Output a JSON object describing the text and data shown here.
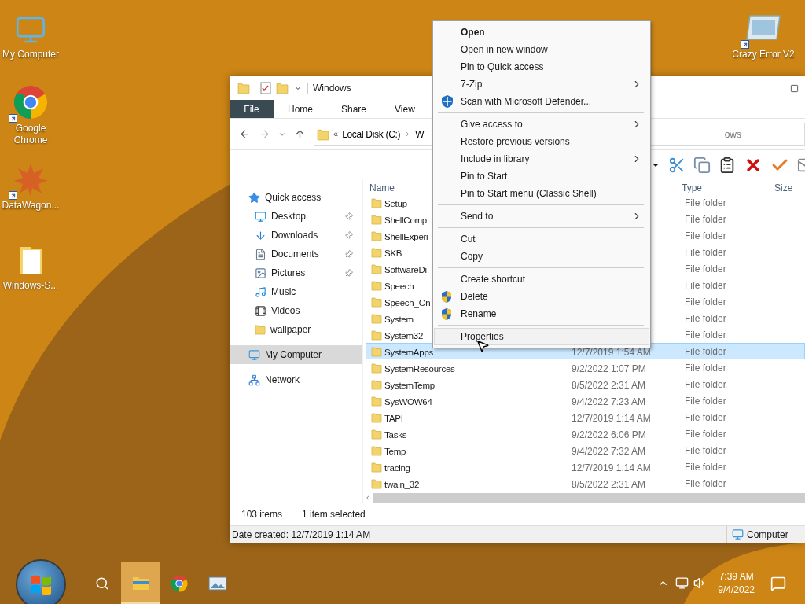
{
  "desktop_icons": [
    {
      "label": "My Computer",
      "kind": "computer",
      "shortcut": false
    },
    {
      "label": "Google Chrome",
      "kind": "chrome",
      "shortcut": true
    },
    {
      "label": "DataWagon...",
      "kind": "star",
      "shortcut": true
    },
    {
      "label": "Windows-S...",
      "kind": "file",
      "shortcut": false
    },
    {
      "label": "Crazy Error V2",
      "kind": "app",
      "shortcut": true
    }
  ],
  "explorer": {
    "title": "Windows",
    "ribbon_tabs": [
      {
        "label": "File",
        "kind": "file"
      },
      {
        "label": "Home",
        "kind": "tab"
      },
      {
        "label": "Share",
        "kind": "tab"
      },
      {
        "label": "View",
        "kind": "tab"
      }
    ],
    "address": {
      "overflow": "«",
      "parent": "Local Disk (C:)",
      "current": "W",
      "tail": "ows"
    },
    "nav": [
      {
        "label": "Quick access",
        "kind": "star",
        "selected": false,
        "children": [
          {
            "label": "Desktop",
            "kind": "desktop",
            "pinned": true,
            "selected": false
          },
          {
            "label": "Downloads",
            "kind": "download",
            "pinned": true,
            "selected": false
          },
          {
            "label": "Documents",
            "kind": "document",
            "pinned": true,
            "selected": false
          },
          {
            "label": "Pictures",
            "kind": "picture",
            "pinned": true,
            "selected": false
          },
          {
            "label": "Music",
            "kind": "music",
            "pinned": false,
            "selected": false
          },
          {
            "label": "Videos",
            "kind": "video",
            "pinned": false,
            "selected": false
          },
          {
            "label": "wallpaper",
            "kind": "folder",
            "pinned": false,
            "selected": false
          }
        ]
      },
      {
        "label": "My Computer",
        "kind": "computer",
        "selected": true
      },
      {
        "label": "Network",
        "kind": "network",
        "selected": false
      }
    ],
    "columns": [
      "Name",
      "Type",
      "Size"
    ],
    "rows": [
      {
        "name": "Setup",
        "type": "File folder",
        "selected": false
      },
      {
        "name": "ShellComp",
        "type": "File folder",
        "selected": false
      },
      {
        "name": "ShellExperi",
        "type": "File folder",
        "selected": false
      },
      {
        "name": "SKB",
        "type": "File folder",
        "selected": false
      },
      {
        "name": "SoftwareDi",
        "type": "File folder",
        "selected": false
      },
      {
        "name": "Speech",
        "type": "File folder",
        "selected": false
      },
      {
        "name": "Speech_On",
        "type": "File folder",
        "selected": false
      },
      {
        "name": "System",
        "type": "File folder",
        "selected": false
      },
      {
        "name": "System32",
        "type": "File folder",
        "selected": false
      },
      {
        "name": "SystemApps",
        "date": "12/7/2019 1:54 AM",
        "type": "File folder",
        "selected": true
      },
      {
        "name": "SystemResources",
        "date": "9/2/2022 1:07 PM",
        "type": "File folder",
        "selected": false
      },
      {
        "name": "SystemTemp",
        "date": "8/5/2022 2:31 AM",
        "type": "File folder",
        "selected": false
      },
      {
        "name": "SysWOW64",
        "date": "9/4/2022 7:23 AM",
        "type": "File folder",
        "selected": false
      },
      {
        "name": "TAPI",
        "date": "12/7/2019 1:14 AM",
        "type": "File folder",
        "selected": false
      },
      {
        "name": "Tasks",
        "date": "9/2/2022 6:06 PM",
        "type": "File folder",
        "selected": false
      },
      {
        "name": "Temp",
        "date": "9/4/2022 7:32 AM",
        "type": "File folder",
        "selected": false
      },
      {
        "name": "tracing",
        "date": "12/7/2019 1:14 AM",
        "type": "File folder",
        "selected": false
      },
      {
        "name": "twain_32",
        "date": "8/5/2022 2:31 AM",
        "type": "File folder",
        "selected": false
      }
    ],
    "status": {
      "count": "103 items",
      "selection": "1 item selected"
    },
    "details": {
      "text": "Date created: 12/7/2019 1:14 AM",
      "location": "Computer"
    }
  },
  "context_menu": {
    "items": [
      {
        "kind": "item",
        "label": "Open",
        "bold": true,
        "submenu": false,
        "selected": false
      },
      {
        "kind": "item",
        "label": "Open in new window",
        "bold": false,
        "submenu": false,
        "selected": false
      },
      {
        "kind": "item",
        "label": "Pin to Quick access",
        "bold": false,
        "submenu": false,
        "selected": false
      },
      {
        "kind": "item",
        "label": "7-Zip",
        "bold": false,
        "submenu": true,
        "selected": false
      },
      {
        "kind": "defender_item",
        "label": "Scan with Microsoft Defender...",
        "bold": false,
        "submenu": false,
        "selected": false
      },
      {
        "kind": "separator"
      },
      {
        "kind": "item",
        "label": "Give access to",
        "bold": false,
        "submenu": true,
        "selected": false
      },
      {
        "kind": "item",
        "label": "Restore previous versions",
        "bold": false,
        "submenu": false,
        "selected": false
      },
      {
        "kind": "item",
        "label": "Include in library",
        "bold": false,
        "submenu": true,
        "selected": false
      },
      {
        "kind": "item",
        "label": "Pin to Start",
        "bold": false,
        "submenu": false,
        "selected": false
      },
      {
        "kind": "item",
        "label": "Pin to Start menu (Classic Shell)",
        "bold": false,
        "submenu": false,
        "selected": false
      },
      {
        "kind": "separator"
      },
      {
        "kind": "item",
        "label": "Send to",
        "bold": false,
        "submenu": true,
        "selected": false
      },
      {
        "kind": "separator"
      },
      {
        "kind": "item",
        "label": "Cut",
        "bold": false,
        "submenu": false,
        "selected": false
      },
      {
        "kind": "item",
        "label": "Copy",
        "bold": false,
        "submenu": false,
        "selected": false
      },
      {
        "kind": "separator"
      },
      {
        "kind": "item",
        "label": "Create shortcut",
        "bold": false,
        "submenu": false,
        "selected": false
      },
      {
        "kind": "shield_item",
        "label": "Delete",
        "bold": false,
        "submenu": false,
        "selected": false
      },
      {
        "kind": "shield_item",
        "label": "Rename",
        "bold": false,
        "submenu": false,
        "selected": false
      },
      {
        "kind": "separator"
      },
      {
        "kind": "item",
        "label": "Properties",
        "bold": false,
        "submenu": false,
        "selected": true
      }
    ]
  },
  "taskbar": {
    "apps": [
      {
        "kind": "search",
        "active": false
      },
      {
        "kind": "explorer",
        "active": true
      },
      {
        "kind": "chrome",
        "active": false
      },
      {
        "kind": "picture",
        "active": false
      }
    ],
    "time": "7:39 AM",
    "date": "9/4/2022"
  }
}
